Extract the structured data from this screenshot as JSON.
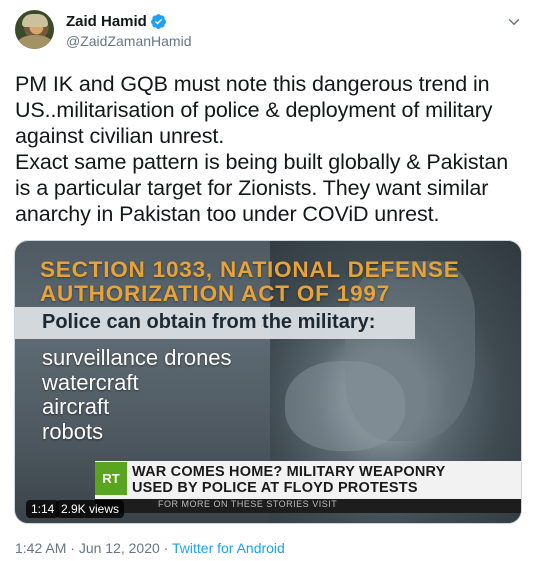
{
  "author": {
    "display_name": "Zaid Hamid",
    "handle": "@ZaidZamanHamid",
    "verified": true
  },
  "tweet": {
    "text": "PM IK and GQB must note this dangerous trend in US..militarisation of police & deployment of military against civilian unrest.\nExact same pattern is being built globally & Pakistan is a particular target for Zionists. They want similar anarchy in Pakistan too under COViD unrest."
  },
  "media": {
    "headline": "SECTION 1033, NATIONAL DEFENSE\nAUTHORIZATION ACT OF 1997",
    "subheading": "Police can obtain from the military:",
    "items": [
      "surveillance drones",
      "watercraft",
      "aircraft",
      "robots"
    ],
    "ticker_logo": "RT",
    "ticker_text": "WAR COMES HOME? MILITARY WEAPONRY\nUSED BY POLICE AT FLOYD PROTESTS",
    "ticker_sub": "FOR MORE ON THESE STORIES VISIT",
    "duration": "1:14",
    "views": "2.9K views"
  },
  "meta": {
    "time": "1:42 AM",
    "separator": " · ",
    "date": "Jun 12, 2020",
    "source": "Twitter for Android"
  },
  "colors": {
    "accent": "#1da1f2",
    "secondary_text": "#657786",
    "headline_orange": "#e7a33a",
    "rt_green": "#5aa51f"
  }
}
